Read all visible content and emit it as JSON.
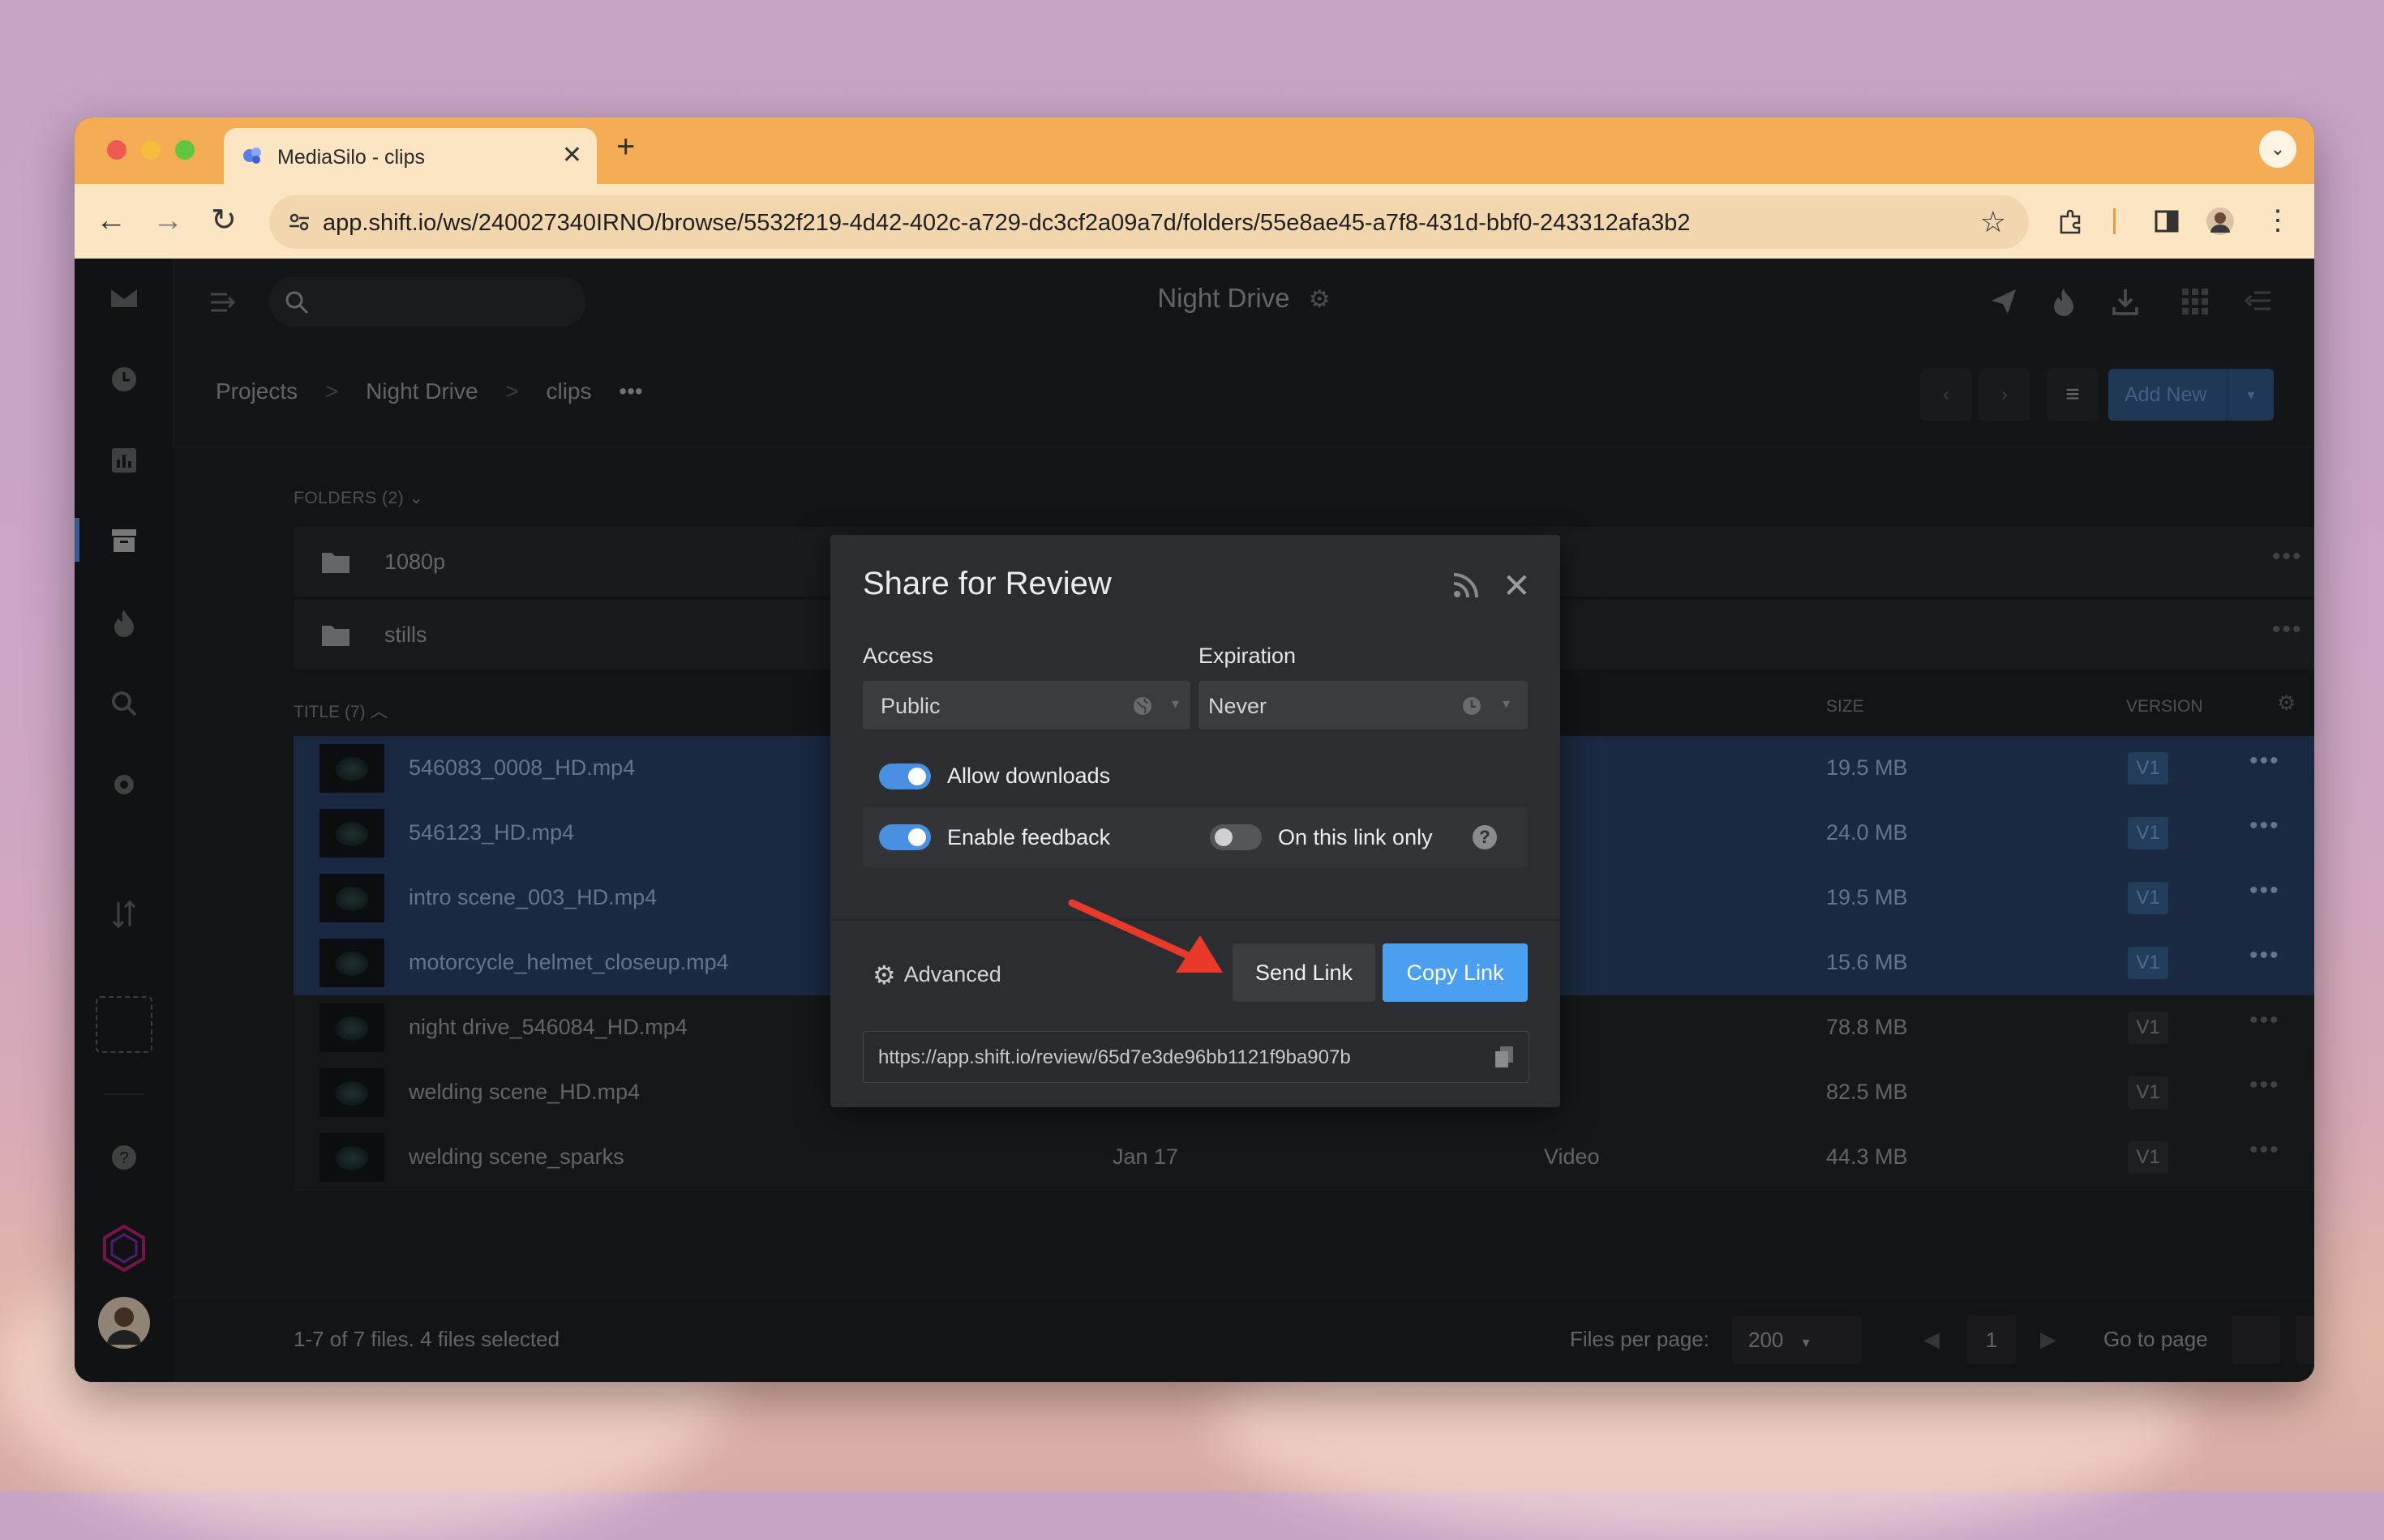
{
  "browser": {
    "tab_title": "MediaSilo - clips",
    "new_tab": "+",
    "url": "app.shift.io/ws/240027340IRNO/browse/5532f219-4d42-402c-a729-dc3cf2a09a7d/folders/55e8ae45-a7f8-431d-bbf0-243312afa3b2",
    "icons": [
      "back-icon",
      "forward-icon",
      "reload-icon",
      "site-settings-icon",
      "bookmark-star-icon",
      "extensions-icon",
      "side-panel-icon",
      "profile-avatar",
      "browser-menu-icon"
    ]
  },
  "app": {
    "project_title": "Night Drive",
    "breadcrumb": [
      "Projects",
      "Night Drive",
      "clips"
    ],
    "breadcrumb_sep": ">",
    "breadcrumb_more": "•••",
    "add_new": "Add New",
    "folders_header": "FOLDERS (2)",
    "folders": [
      {
        "name": "1080p"
      },
      {
        "name": "stills"
      }
    ],
    "columns": {
      "title": "TITLE (7)",
      "size": "SIZE",
      "version": "VERSION"
    },
    "files": [
      {
        "name": "546083_0008_HD.mp4",
        "date": "",
        "type": "",
        "size": "19.5 MB",
        "version": "V1",
        "selected": true
      },
      {
        "name": "546123_HD.mp4",
        "date": "",
        "type": "",
        "size": "24.0 MB",
        "version": "V1",
        "selected": true
      },
      {
        "name": "intro scene_003_HD.mp4",
        "date": "",
        "type": "",
        "size": "19.5 MB",
        "version": "V1",
        "selected": true
      },
      {
        "name": "motorcycle_helmet_closeup.mp4",
        "date": "",
        "type": "",
        "size": "15.6 MB",
        "version": "V1",
        "selected": true
      },
      {
        "name": "night drive_546084_HD.mp4",
        "date": "",
        "type": "",
        "size": "78.8 MB",
        "version": "V1",
        "selected": false
      },
      {
        "name": "welding scene_HD.mp4",
        "date": "",
        "type": "",
        "size": "82.5 MB",
        "version": "V1",
        "selected": false
      },
      {
        "name": "welding scene_sparks",
        "date": "Jan 17",
        "type": "Video",
        "size": "44.3 MB",
        "version": "V1",
        "selected": false
      }
    ],
    "footer": {
      "summary": "1-7 of 7 files. 4 files selected",
      "per_page_label": "Files per page:",
      "per_page_value": "200",
      "current_page": "1",
      "goto_label": "Go to page"
    }
  },
  "modal": {
    "title": "Share for Review",
    "access_label": "Access",
    "access_value": "Public",
    "expiration_label": "Expiration",
    "expiration_value": "Never",
    "allow_downloads": "Allow downloads",
    "allow_downloads_on": true,
    "enable_feedback": "Enable feedback",
    "enable_feedback_on": true,
    "link_only": "On this link only",
    "link_only_on": false,
    "help": "?",
    "advanced": "Advanced",
    "send_link": "Send Link",
    "copy_link": "Copy Link",
    "share_url": "https://app.shift.io/review/65d7e3de96bb1121f9ba907b"
  },
  "colors": {
    "accent": "#4a9ff0",
    "selected_row": "#243a5a",
    "tab_bar": "#f4ac55",
    "annotation_arrow": "#e8392a"
  }
}
